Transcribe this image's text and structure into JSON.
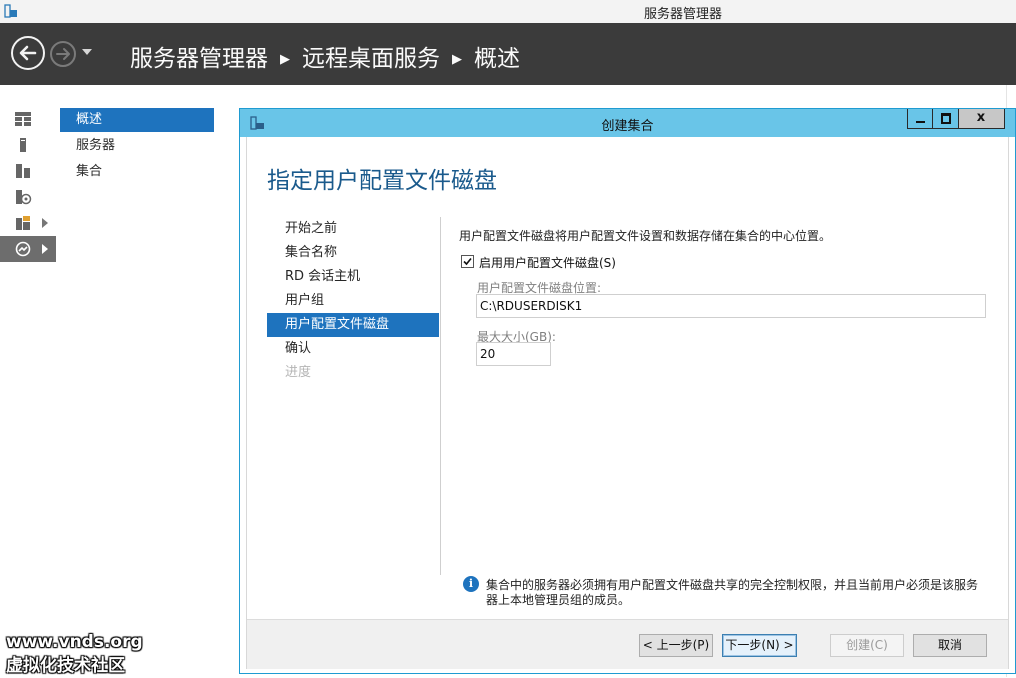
{
  "window": {
    "title": "服务器管理器"
  },
  "breadcrumb": {
    "items": [
      "服务器管理器",
      "远程桌面服务",
      "概述"
    ]
  },
  "rail": {
    "items": [
      {
        "icon": "dashboard-icon"
      },
      {
        "icon": "local-server-icon"
      },
      {
        "icon": "all-servers-icon"
      },
      {
        "icon": "file-services-icon"
      },
      {
        "icon": "file-storage-icon"
      },
      {
        "icon": "remote-desktop-icon"
      }
    ]
  },
  "subnav": {
    "items": [
      "概述",
      "服务器",
      "集合"
    ],
    "active": 0
  },
  "dialog": {
    "title": "创建集合",
    "close_glyph": "x",
    "heading": "指定用户配置文件磁盘",
    "steps": [
      "开始之前",
      "集合名称",
      "RD 会话主机",
      "用户组",
      "用户配置文件磁盘",
      "确认",
      "进度"
    ],
    "active_step": 4,
    "description": "用户配置文件磁盘将用户配置文件设置和数据存储在集合的中心位置。",
    "enable_checkbox": {
      "label": "启用用户配置文件磁盘(S)",
      "checked": true
    },
    "location": {
      "label": "用户配置文件磁盘位置:",
      "value": "C:\\RDUSERDISK1"
    },
    "max_size": {
      "label": "最大大小(GB):",
      "value": "20"
    },
    "info_icon": "i",
    "info_text": "集合中的服务器必须拥有用户配置文件磁盘共享的完全控制权限，并且当前用户必须是该服务器上本地管理员组的成员。",
    "buttons": {
      "prev": "< 上一步(P)",
      "next": "下一步(N) >",
      "create": "创建(C)",
      "cancel": "取消"
    }
  },
  "watermark": {
    "line1": "www.vnds.org",
    "line2": "虚拟化技术社区"
  },
  "colors": {
    "accent": "#1e73be",
    "dialog_title": "#69c5e8",
    "navbar": "#3b3b3b",
    "heading": "#1a5a8c"
  }
}
